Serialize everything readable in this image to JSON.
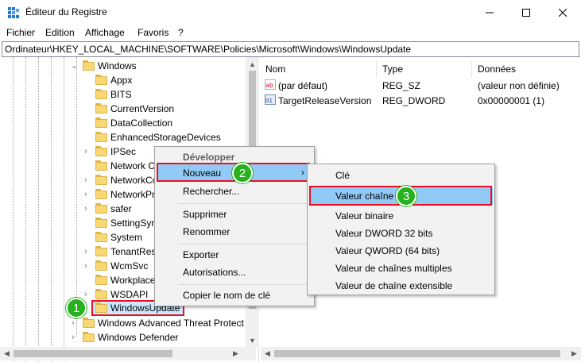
{
  "window": {
    "title": "Éditeur du Registre",
    "icon": "registry-editor-icon"
  },
  "menu": [
    "Fichier",
    "Edition",
    "Affichage",
    "Favoris",
    "?"
  ],
  "address": "Ordinateur\\HKEY_LOCAL_MACHINE\\SOFTWARE\\Policies\\Microsoft\\Windows\\WindowsUpdate",
  "tree": {
    "parent": "Windows",
    "children": [
      "Appx",
      "BITS",
      "CurrentVersion",
      "DataCollection",
      "EnhancedStorageDevices",
      "IPSec",
      "Network C",
      "NetworkCo",
      "NetworkPr",
      "safer",
      "SettingSyn",
      "System",
      "TenantRest",
      "WcmSvc",
      "Workplace",
      "WSDAPI",
      "WindowsUpdate"
    ],
    "siblings": [
      "Windows Advanced Threat Protect",
      "Windows Defender"
    ]
  },
  "list": {
    "headers": [
      "Nom",
      "Type",
      "Données"
    ],
    "rows": [
      {
        "name": "(par défaut)",
        "type": "REG_SZ",
        "data": "(valeur non définie)",
        "icon": "string-value-icon"
      },
      {
        "name": "TargetReleaseVersion",
        "type": "REG_DWORD",
        "data": "0x00000001 (1)",
        "icon": "dword-value-icon"
      }
    ]
  },
  "context_menu": {
    "items": [
      "Développer",
      "Nouveau",
      "Rechercher...",
      "Supprimer",
      "Renommer",
      "Exporter",
      "Autorisations...",
      "Copier le nom de clé"
    ]
  },
  "submenu": {
    "items": [
      "Clé",
      "Valeur chaîne",
      "Valeur binaire",
      "Valeur DWORD 32 bits",
      "Valeur QWORD (64 bits)",
      "Valeur de chaînes multiples",
      "Valeur de chaîne extensible"
    ]
  },
  "badges": [
    "1",
    "2",
    "3"
  ],
  "colors": {
    "highlight": "#91c9f7",
    "annotation_red": "#e81123",
    "badge_green": "#27b01f",
    "folder": "#f8d775"
  }
}
